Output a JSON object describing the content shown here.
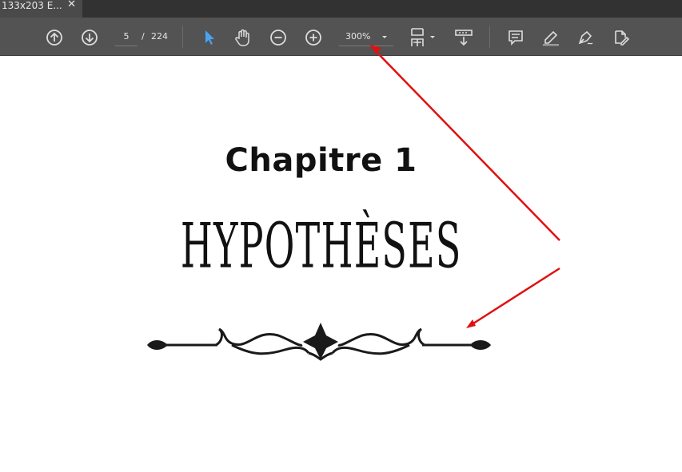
{
  "tab": {
    "title": "133x203 E...",
    "close_glyph": "✕"
  },
  "toolbar": {
    "current_page": "5",
    "page_separator": "/",
    "total_pages": "224",
    "zoom": "300%",
    "icons": [
      "page-up-icon",
      "page-down-icon",
      "select-arrow-icon",
      "hand-tool-icon",
      "zoom-out-icon",
      "zoom-in-icon",
      "zoom-dropdown-icon",
      "fit-page-icon",
      "scroll-mode-icon",
      "comment-icon",
      "highlight-icon",
      "draw-icon",
      "fill-sign-icon"
    ]
  },
  "document": {
    "title": "Chapitre 1",
    "heading": "HYPOTHÈSES"
  },
  "colors": {
    "toolbar_bg": "#535353",
    "tab_bg": "#4a4a4a",
    "select_tool_accent": "#4aa3f0",
    "arrow_annotation": "#e01010"
  }
}
